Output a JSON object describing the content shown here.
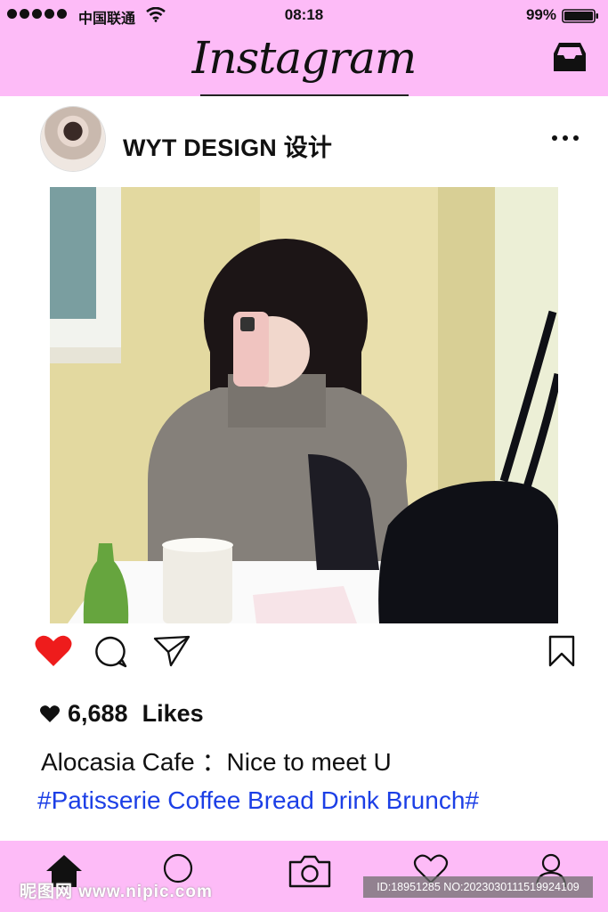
{
  "status_bar": {
    "carrier": "中国联通",
    "time": "08:18",
    "battery": "99%"
  },
  "header": {
    "app_title": "Instagram"
  },
  "post": {
    "username": "WYT DESIGN 设计",
    "likes_count": "6,688",
    "likes_label": "Likes",
    "caption": "Alocasia Cafe ：Nice to meet U",
    "hashtags": "#Patisserie Coffee Bread Drink Brunch#",
    "liked": true
  },
  "watermark": {
    "left": "昵图网 www.nipic.com",
    "right": "ID:18951285 NO:20230301115199241​09"
  },
  "colors": {
    "brand_pink": "#fdbbf7",
    "like_red": "#ee1c1c",
    "hashtag_blue": "#1c3fe6"
  },
  "icons": [
    "signal-dots-icon",
    "wifi-icon",
    "battery-icon",
    "inbox-icon",
    "more-icon",
    "heart-icon",
    "comment-icon",
    "share-icon",
    "bookmark-icon",
    "home-icon",
    "search-icon",
    "camera-icon",
    "activity-heart-icon",
    "profile-icon"
  ]
}
